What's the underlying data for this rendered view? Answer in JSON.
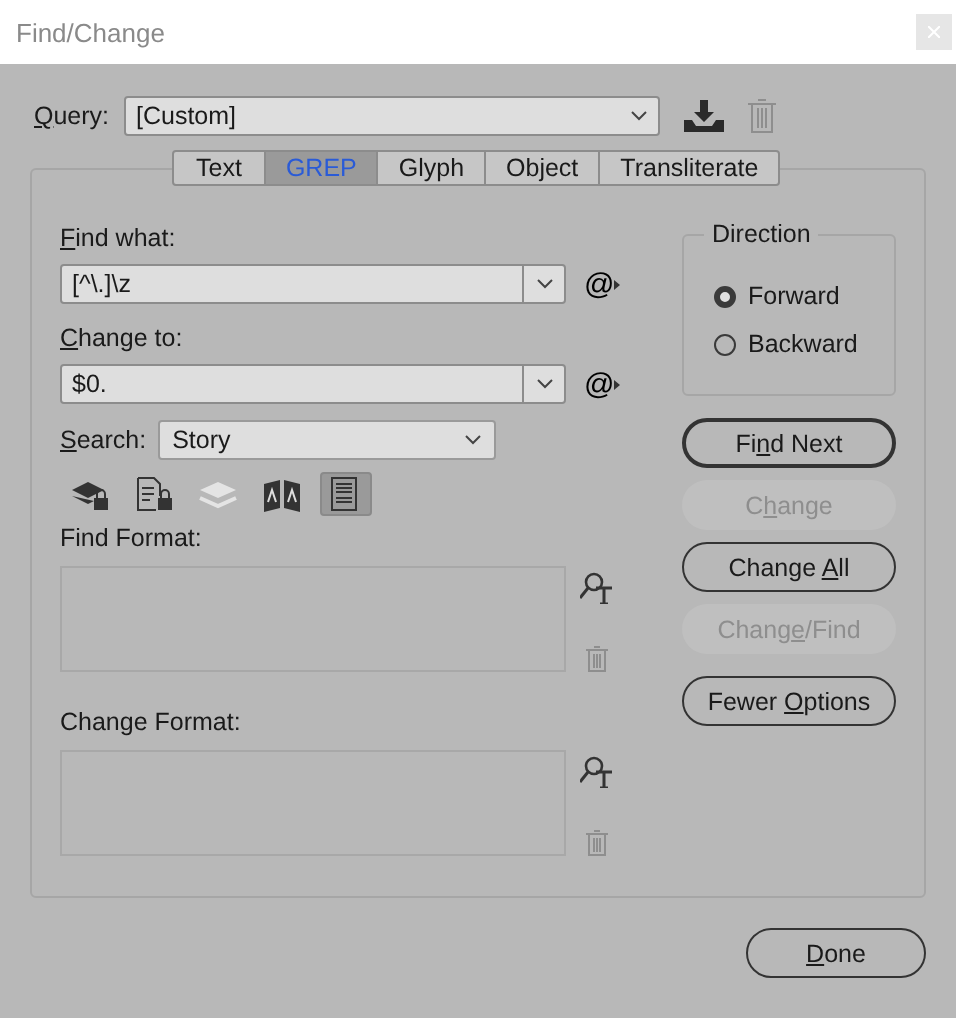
{
  "window": {
    "title": "Find/Change"
  },
  "query": {
    "label": {
      "key": "Q",
      "after": "uery:"
    },
    "value": "[Custom]"
  },
  "tabs": [
    {
      "label": "Text",
      "selected": false
    },
    {
      "label": "GREP",
      "selected": true
    },
    {
      "label": "Glyph",
      "selected": false
    },
    {
      "label": "Object",
      "selected": false
    },
    {
      "label": "Transliterate",
      "selected": false
    }
  ],
  "find_what": {
    "label": {
      "key": "F",
      "after": "ind what:"
    },
    "value": "[^\\.]\\z",
    "special_menu": "@"
  },
  "change_to": {
    "label": {
      "key": "C",
      "after": "hange to:"
    },
    "value": "$0.",
    "special_menu": "@"
  },
  "search": {
    "label": {
      "key": "S",
      "after": "earch:"
    },
    "value": "Story"
  },
  "search_options": [
    {
      "kind": "locked-layers",
      "on": false
    },
    {
      "kind": "locked-stories",
      "on": false
    },
    {
      "kind": "hidden-layers",
      "on": false
    },
    {
      "kind": "master-pages",
      "on": false
    },
    {
      "kind": "footnotes",
      "on": true
    }
  ],
  "find_format": {
    "label": "Find Format:"
  },
  "change_format": {
    "label": "Change Format:"
  },
  "direction": {
    "title": "Direction",
    "options": [
      {
        "label": "Forward",
        "selected": true
      },
      {
        "label": "Backward",
        "selected": false
      }
    ]
  },
  "buttons": [
    {
      "label": {
        "before": "Fi",
        "key": "n",
        "after": "d Next"
      },
      "disabled": false,
      "default": true
    },
    {
      "label": {
        "before": "C",
        "key": "h",
        "after": "ange"
      },
      "disabled": true,
      "default": false
    },
    {
      "label": {
        "before": "Change ",
        "key": "A",
        "after": "ll"
      },
      "disabled": false,
      "default": false
    },
    {
      "label": {
        "before": "Chang",
        "key": "e",
        "after": "/Find"
      },
      "disabled": true,
      "default": false
    },
    {
      "label": {
        "before": "Fewer ",
        "key": "O",
        "after": "ptions"
      },
      "disabled": false,
      "default": false
    }
  ],
  "done": {
    "label": {
      "key": "D",
      "after": "one"
    }
  }
}
